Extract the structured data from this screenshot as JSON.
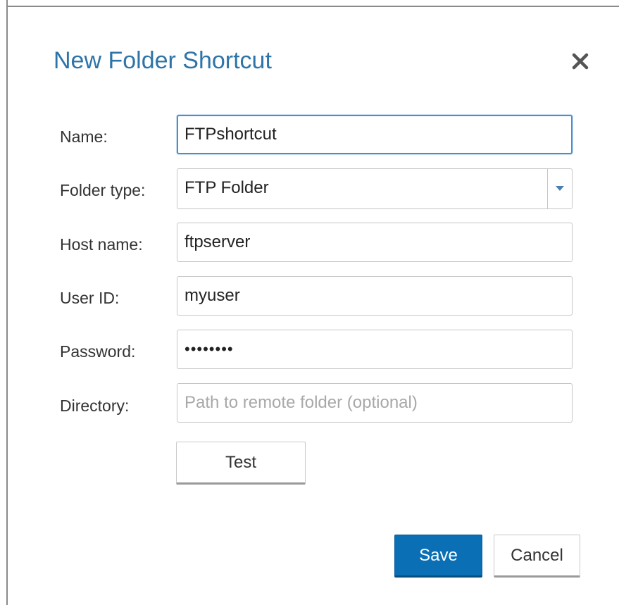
{
  "dialog": {
    "title": "New Folder Shortcut",
    "close_icon": "close-icon"
  },
  "form": {
    "name": {
      "label": "Name:",
      "value": "FTPshortcut"
    },
    "folder_type": {
      "label": "Folder type:",
      "value": "FTP Folder",
      "arrow_icon": "caret-down-icon"
    },
    "host_name": {
      "label": "Host name:",
      "value": "ftpserver"
    },
    "user_id": {
      "label": "User ID:",
      "value": "myuser"
    },
    "password": {
      "label": "Password:",
      "value": "••••••••"
    },
    "directory": {
      "label": "Directory:",
      "value": "",
      "placeholder": "Path to remote folder (optional)"
    }
  },
  "buttons": {
    "test": "Test",
    "save": "Save",
    "cancel": "Cancel"
  },
  "colors": {
    "title": "#2e74a8",
    "primary_button": "#0a6fb5",
    "focus_border": "#4a8fd0",
    "caret": "#4a7fb5"
  }
}
